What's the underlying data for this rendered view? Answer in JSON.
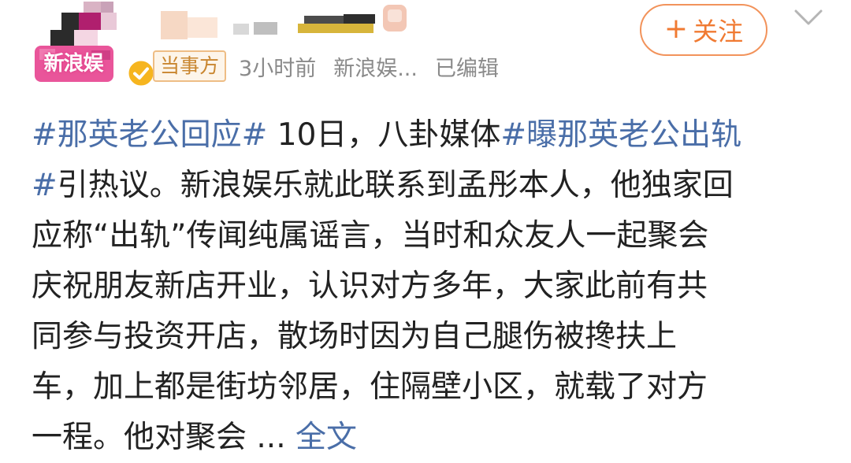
{
  "account": {
    "avatar_label": "新浪娱",
    "role_badge": "当事方",
    "time_posted": "3小时前",
    "source": "新浪娱...",
    "edited_label": "已编辑"
  },
  "actions": {
    "follow_plus": "+",
    "follow_label": "关注"
  },
  "colors": {
    "follow_accent": "#f07a32",
    "link_blue": "#4a6ea8",
    "badge_border": "#eebd85",
    "badge_text": "#c9862f",
    "verified_yellow": "#f6b51f"
  },
  "icons": {
    "verified": "verified-badge-icon",
    "more": "chevron-down-icon"
  },
  "post": {
    "topic1": "#那英老公回应#",
    "line1_text": " 10日，八卦媒体",
    "topic2": "#曝那英老公出轨",
    "topic2_end": "#",
    "line2_text": "引热议。新浪娱乐就此联系到孟彤本人，他独家回",
    "line3": "应称“出轨”传闻纯属谣言，当时和众友人一起聚会",
    "line4": "庆祝朋友新店开业，认识对方多年，大家此前有共",
    "line5": "同参与投资开店，散场时因为自己腿伤被搀扶上",
    "line6": "车，加上都是街坊邻居，住隔壁小区，就载了对方",
    "line7_text": "一程。他对聚会 ... ",
    "full_text_link": "全文"
  }
}
